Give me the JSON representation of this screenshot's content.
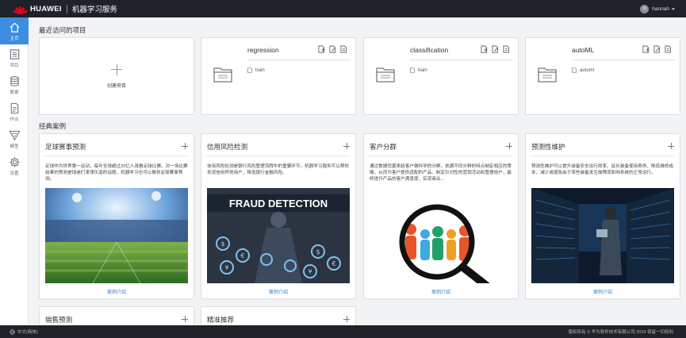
{
  "header": {
    "brand": "HUAWEI",
    "app_name": "机器学习服务",
    "user_avatar": "hi",
    "user_name": "hannah"
  },
  "sidebar": {
    "items": [
      {
        "label": "主页",
        "icon": "home-icon"
      },
      {
        "label": "项目",
        "icon": "project-icon"
      },
      {
        "label": "数据",
        "icon": "database-icon"
      },
      {
        "label": "作业",
        "icon": "job-icon"
      },
      {
        "label": "模型",
        "icon": "model-icon"
      },
      {
        "label": "设置",
        "icon": "settings-icon"
      }
    ]
  },
  "recent": {
    "title": "最近访问的项目",
    "create_label": "创建项目",
    "projects": [
      {
        "name": "regression",
        "item": "train"
      },
      {
        "name": "classification",
        "item": "train"
      },
      {
        "name": "autoML",
        "item": "automl"
      }
    ]
  },
  "cases": {
    "title": "经典案例",
    "link_label": "案例介绍",
    "items": [
      {
        "title": "足球赛事预测",
        "desc": "足球作为世界第一运动，每年全球超过20亿人观看足球比赛。对一场比赛结果的预测是球迷们津津乐道的话题。机器学习也可以做到足球赛事预测。"
      },
      {
        "title": "信用风险检测",
        "desc": "信用风险检测是银行风险管理流程中的重要环节。机器学习服务可以帮你发现信用异常用户，降低银行金融风险。",
        "image_text": "FRAUD DETECTION"
      },
      {
        "title": "客户分群",
        "desc": "通过数据挖掘来给客户做科学的分群，依据不同分群的特点制定相应的策略，从而为客户提供适配的产品、制定针对性的营销活动和管理用户，最终提升产品的客户满意度，实现商业..."
      },
      {
        "title": "预测性维护",
        "desc": "预测性维护可以提升装备安全运行效率、延长装备使用寿命、降低维修成本，减少或避免由于某些装备发生故障而影响系统的正常运行。"
      }
    ],
    "more": [
      {
        "title": "销售预测"
      },
      {
        "title": "精准推荐"
      }
    ]
  },
  "footer": {
    "language": "中文(简体)",
    "copyright": "版权所有 © 华为软件技术有限公司 2019  保留一切权利"
  },
  "colors": {
    "topbar": "#1f2229",
    "accent": "#3b8ee0",
    "brand_red": "#e60012",
    "link": "#2f7fd6"
  }
}
